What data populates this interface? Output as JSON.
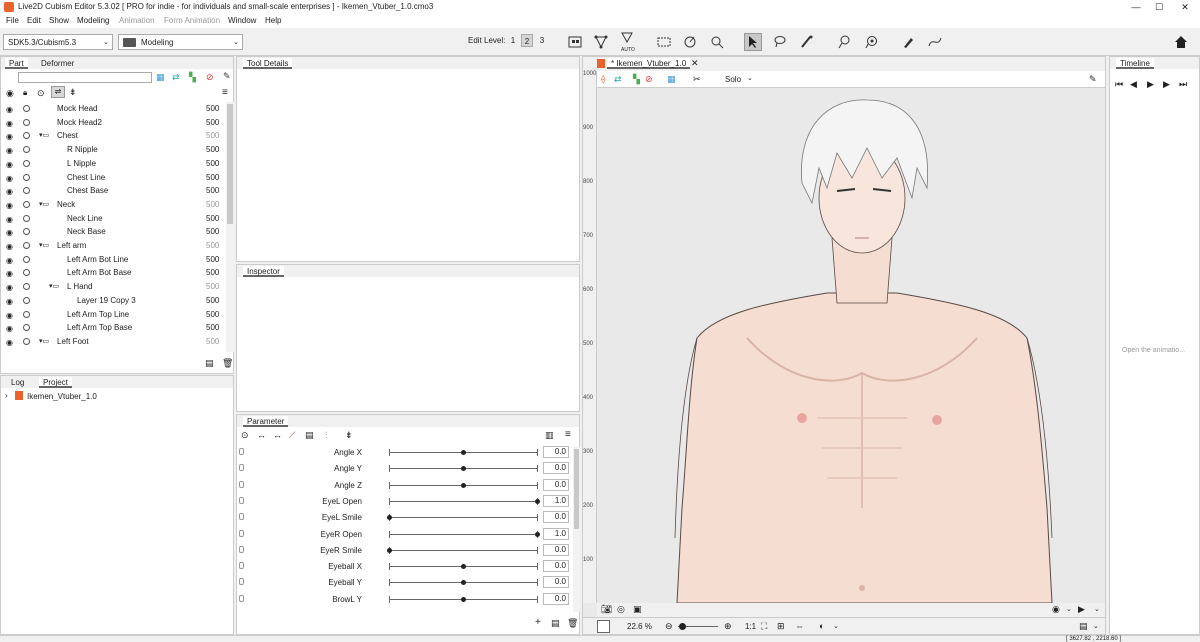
{
  "titlebar": {
    "title": "Live2D Cubism Editor 5.3.02   [ PRO for indie - for individuals and small-scale enterprises ]  - Ikemen_Vtuber_1.0.cmo3",
    "controls": [
      "—",
      "☐",
      "✕"
    ]
  },
  "menu": [
    "File",
    "Edit",
    "Show",
    "Modeling",
    "Animation",
    "Form Animation",
    "Window",
    "Help"
  ],
  "toolbar": {
    "sdk_select": "SDK5.3/Cubism5.3",
    "mode_select": "Modeling",
    "edit_level_label": "Edit Level:",
    "edit_levels": [
      "1",
      "2",
      "3"
    ],
    "auto_label": "AUTO"
  },
  "left_panel": {
    "tabs": [
      "Part",
      "Deformer"
    ],
    "tree": [
      {
        "name": "Mock Head",
        "value": "500",
        "indent": 0,
        "kind": "item",
        "dim": false
      },
      {
        "name": "Mock Head2",
        "value": "500",
        "indent": 0,
        "kind": "item",
        "dim": false
      },
      {
        "name": "Chest",
        "value": "500",
        "indent": 0,
        "kind": "folder",
        "dim": true
      },
      {
        "name": "R Nipple",
        "value": "500",
        "indent": 1,
        "kind": "item",
        "dim": false
      },
      {
        "name": "L Nipple",
        "value": "500",
        "indent": 1,
        "kind": "item",
        "dim": false
      },
      {
        "name": "Chest Line",
        "value": "500",
        "indent": 1,
        "kind": "item",
        "dim": false
      },
      {
        "name": "Chest Base",
        "value": "500",
        "indent": 1,
        "kind": "item",
        "dim": false
      },
      {
        "name": "Neck",
        "value": "500",
        "indent": 0,
        "kind": "folder",
        "dim": true
      },
      {
        "name": "Neck Line",
        "value": "500",
        "indent": 1,
        "kind": "item",
        "dim": false
      },
      {
        "name": "Neck Base",
        "value": "500",
        "indent": 1,
        "kind": "item",
        "dim": false
      },
      {
        "name": "Left arm",
        "value": "500",
        "indent": 0,
        "kind": "folder",
        "dim": true
      },
      {
        "name": "Left Arm Bot Line",
        "value": "500",
        "indent": 1,
        "kind": "item",
        "dim": false
      },
      {
        "name": "Left Arm Bot Base",
        "value": "500",
        "indent": 1,
        "kind": "item",
        "dim": false
      },
      {
        "name": "L Hand",
        "value": "500",
        "indent": 1,
        "kind": "folder",
        "dim": true
      },
      {
        "name": "Layer 19 Copy 3",
        "value": "500",
        "indent": 2,
        "kind": "item",
        "dim": false
      },
      {
        "name": "Left Arm Top Line",
        "value": "500",
        "indent": 1,
        "kind": "item",
        "dim": false
      },
      {
        "name": "Left Arm Top Base",
        "value": "500",
        "indent": 1,
        "kind": "item",
        "dim": false
      },
      {
        "name": "Left Foot",
        "value": "500",
        "indent": 0,
        "kind": "folder",
        "dim": true
      }
    ]
  },
  "bottom_left": {
    "tabs": [
      "Log",
      "Project"
    ],
    "project_item": "Ikemen_Vtuber_1.0"
  },
  "tool_details": {
    "tab": "Tool Details"
  },
  "inspector": {
    "tab": "Inspector"
  },
  "parameter": {
    "tab": "Parameter",
    "rows": [
      {
        "name": "Angle X",
        "value": "0.0",
        "pos": 0.5
      },
      {
        "name": "Angle Y",
        "value": "0.0",
        "pos": 0.5
      },
      {
        "name": "Angle Z",
        "value": "0.0",
        "pos": 0.5
      },
      {
        "name": "EyeL Open",
        "value": "1.0",
        "pos": 1.0
      },
      {
        "name": "EyeL Smile",
        "value": "0.0",
        "pos": 0.0
      },
      {
        "name": "EyeR Open",
        "value": "1.0",
        "pos": 1.0
      },
      {
        "name": "EyeR Smile",
        "value": "0.0",
        "pos": 0.0
      },
      {
        "name": "Eyeball X",
        "value": "0.0",
        "pos": 0.5
      },
      {
        "name": "Eyeball Y",
        "value": "0.0",
        "pos": 0.5
      },
      {
        "name": "BrowL Y",
        "value": "0.0",
        "pos": 0.5
      }
    ]
  },
  "viewer": {
    "tab": "* Ikemen_Vtuber_1.0",
    "solo_label": "Solo",
    "ruler": [
      "1000",
      "900",
      "800",
      "700",
      "600",
      "500",
      "400",
      "300",
      "200",
      "100"
    ],
    "zoom": "22.6 %",
    "ratio": "1:1"
  },
  "timeline": {
    "tab": "Timeline",
    "placeholder": "Open the animatio..."
  },
  "status": {
    "coords": "[ 3627.82 , 2218.60 ]"
  },
  "colors": {
    "accent": "#e8632b",
    "skin": "#f4dcd0",
    "canvas_bg": "#e9e9e9"
  }
}
